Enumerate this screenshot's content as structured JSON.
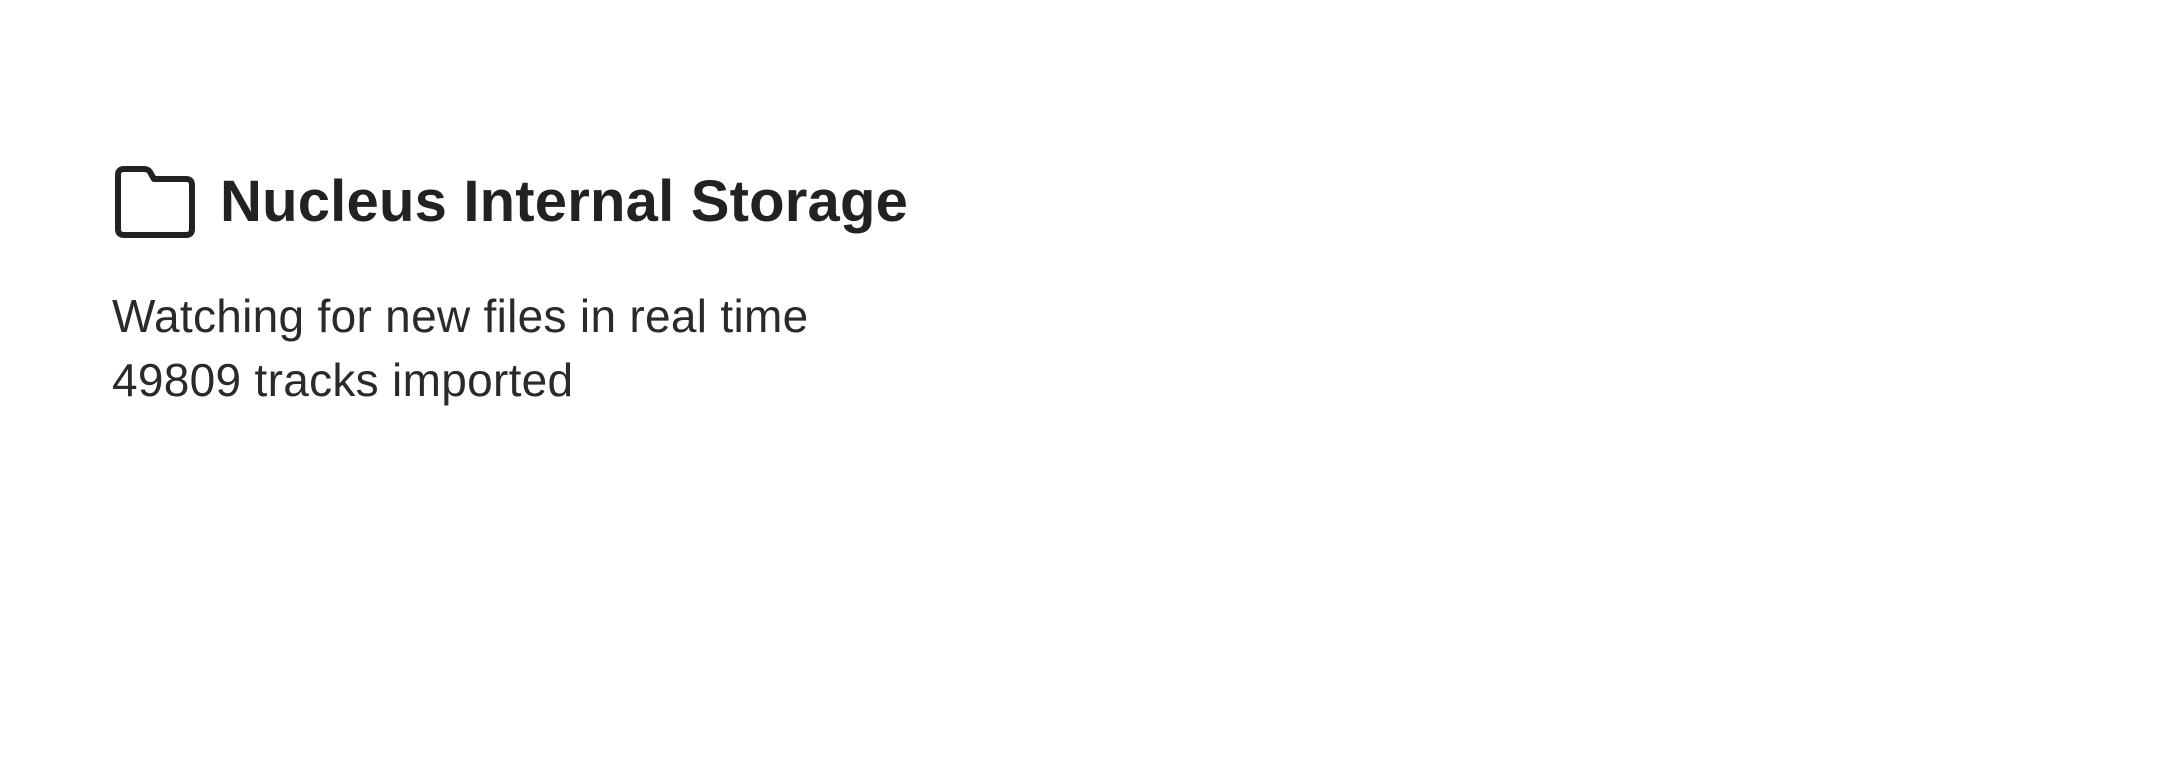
{
  "storage": {
    "icon": "folder-icon",
    "title": "Nucleus Internal Storage",
    "status": "Watching for new files in real time",
    "tracks_imported": "49809 tracks imported"
  },
  "colors": {
    "text": "#222222",
    "background": "#ffffff"
  }
}
